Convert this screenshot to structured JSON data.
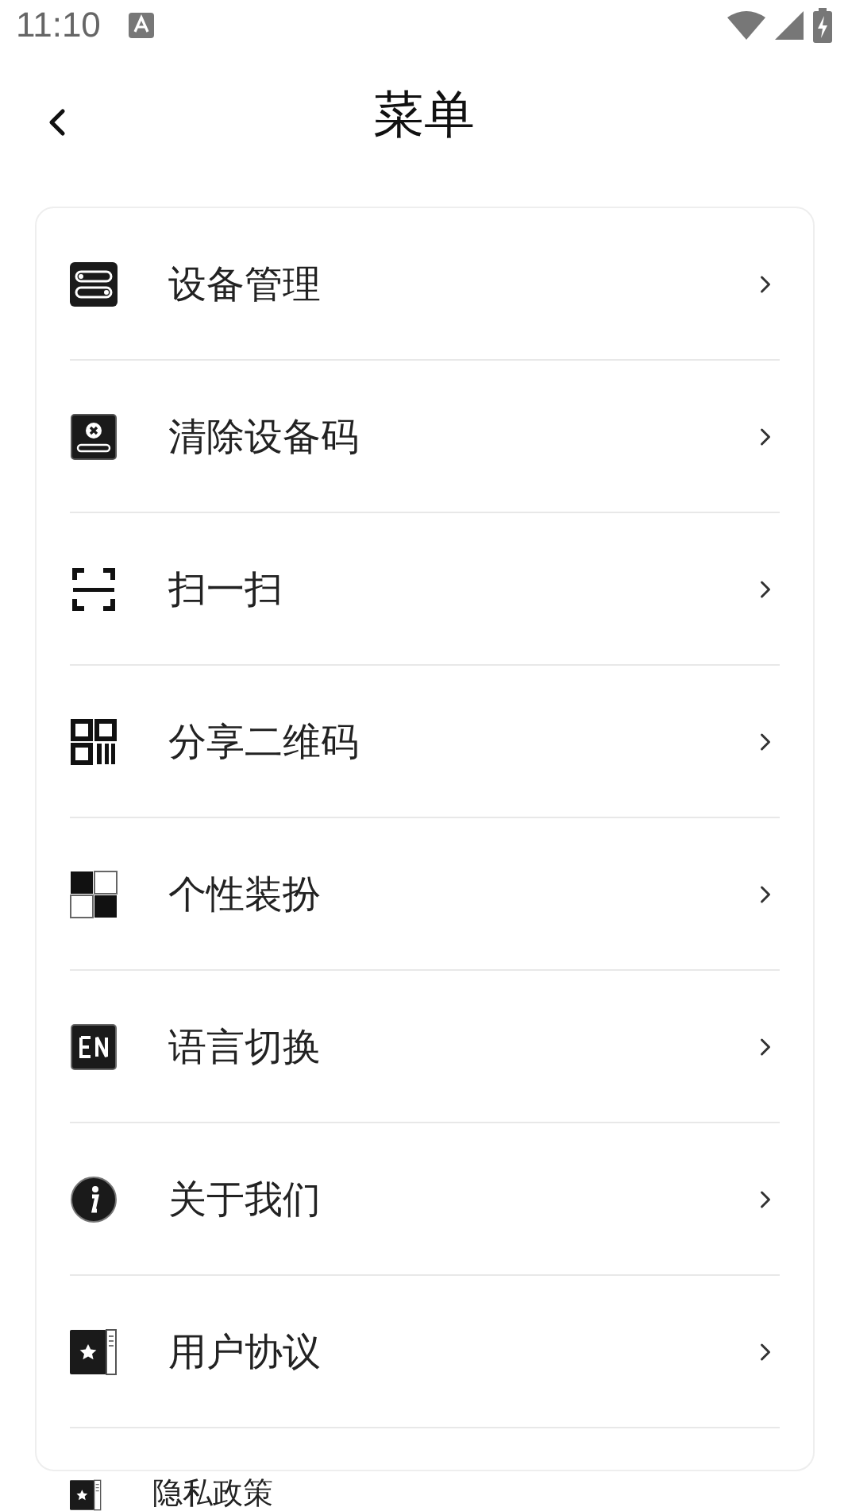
{
  "status_bar": {
    "time": "11:10"
  },
  "header": {
    "title": "菜单"
  },
  "menu": [
    {
      "kind": "device",
      "label": "设备管理"
    },
    {
      "kind": "clear",
      "label": "清除设备码"
    },
    {
      "kind": "scan",
      "label": "扫一扫"
    },
    {
      "kind": "qr",
      "label": "分享二维码"
    },
    {
      "kind": "theme",
      "label": "个性装扮"
    },
    {
      "kind": "language",
      "label": "语言切换"
    },
    {
      "kind": "about",
      "label": "关于我们"
    },
    {
      "kind": "book",
      "label": "用户协议"
    }
  ],
  "below_card": [
    {
      "kind": "book",
      "label": "隐私政策"
    }
  ]
}
